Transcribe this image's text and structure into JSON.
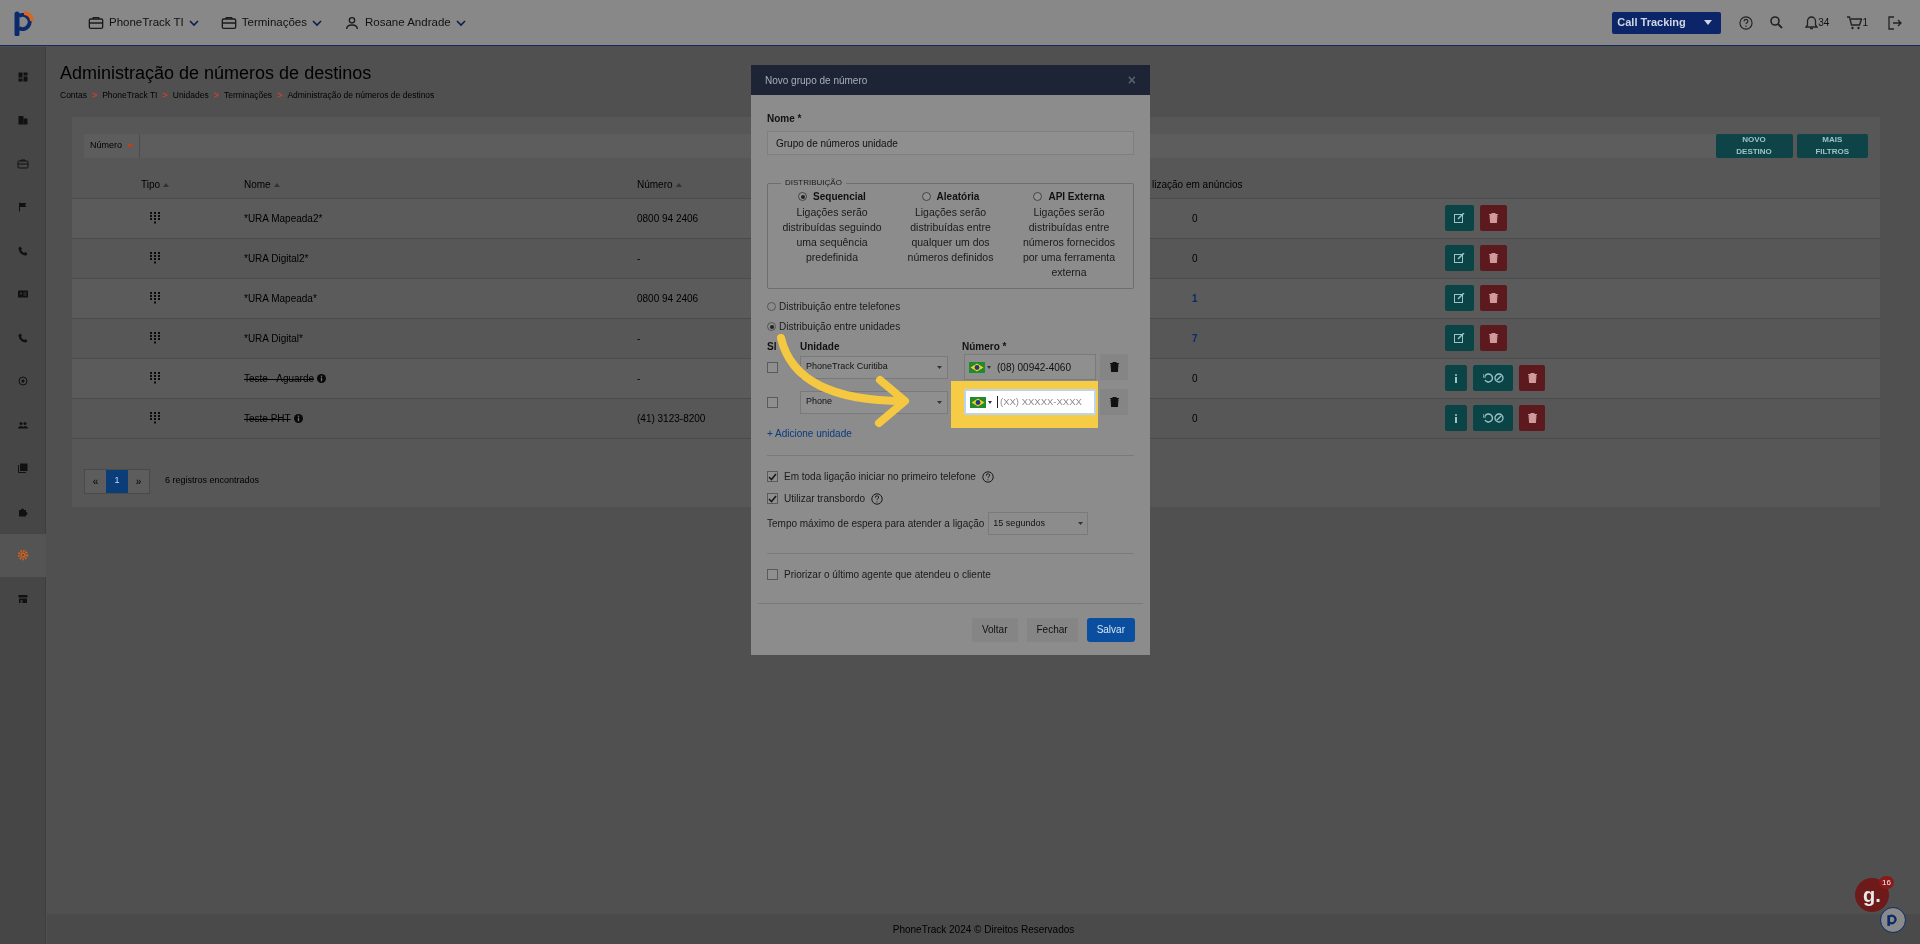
{
  "topbar": {
    "menus": [
      {
        "label": "PhoneTrack TI"
      },
      {
        "label": "Terminações"
      },
      {
        "label": "Rosane Andrade"
      }
    ],
    "product_select": "Call Tracking",
    "notifications": "34",
    "cart": "1"
  },
  "sidebar": {
    "items": [
      {
        "selected": false
      },
      {
        "selected": false
      },
      {
        "selected": false
      },
      {
        "selected": false
      },
      {
        "selected": false
      },
      {
        "selected": false
      },
      {
        "selected": false
      },
      {
        "selected": false
      },
      {
        "selected": false
      },
      {
        "selected": false
      },
      {
        "selected": false
      },
      {
        "selected": true
      },
      {
        "selected": false
      }
    ]
  },
  "page": {
    "title": "Administração de números de destinos",
    "breadcrumb": [
      "Contas",
      "PhoneTrack TI",
      "Unidades",
      "Terminações",
      "Administração de números de destinos"
    ],
    "separator": ">"
  },
  "filter": {
    "field_label": "Número",
    "buttons": [
      "NOVO DESTINO",
      "MAIS FILTROS"
    ]
  },
  "table": {
    "columns": [
      "Tipo",
      "Nome",
      "Número",
      "lização em anúncios"
    ],
    "rows": [
      {
        "name": "*URA Mapeada2*",
        "number": "0800 94 2406",
        "usage": "0",
        "usage_linked": false,
        "disabled": false
      },
      {
        "name": "*URA Digital2*",
        "number": "-",
        "usage": "0",
        "usage_linked": false,
        "disabled": false
      },
      {
        "name": "*URA Mapeada*",
        "number": "0800 94 2406",
        "usage": "1",
        "usage_linked": true,
        "disabled": false
      },
      {
        "name": "*URA Digital*",
        "number": "-",
        "usage": "7",
        "usage_linked": true,
        "disabled": false
      },
      {
        "name": "Teste - Aguarde",
        "number": "-",
        "usage": "0",
        "usage_linked": false,
        "disabled": true
      },
      {
        "name": "Teste PHT",
        "number": "(41) 3123-8200",
        "usage": "0",
        "usage_linked": false,
        "disabled": true
      }
    ]
  },
  "pagination": {
    "prev": "«",
    "pages": [
      {
        "label": "1",
        "selected": true
      }
    ],
    "next": "»",
    "summary": "6 registros encontrados"
  },
  "footer": "PhoneTrack 2024 © Direitos Reservados",
  "modal": {
    "title": "Novo grupo de número",
    "close": "×",
    "name_label": "Nome *",
    "name_value": "Grupo de números unidade",
    "distribution": {
      "legend": "DISTRIBUIÇÃO",
      "options": [
        {
          "title": "Sequencial",
          "description": "Ligações serão distribuídas seguindo uma sequência predefinida",
          "selected": true
        },
        {
          "title": "Aleatória",
          "description": "Ligações serão distribuídas entre qualquer um dos números definidos",
          "selected": false
        },
        {
          "title": "API Externa",
          "description": "Ligações serão distribuídas entre números fornecidos por uma ferramenta externa",
          "selected": false
        }
      ]
    },
    "modes": [
      {
        "label": "Distribuição entre telefones",
        "selected": false
      },
      {
        "label": "Distribuição entre unidades",
        "selected": true
      }
    ],
    "units": {
      "columns": [
        "Sl",
        "Unidade",
        "Número *"
      ],
      "rows": [
        {
          "checked": false,
          "unit": "PhoneTrack Curitiba",
          "number": "(08) 00942-4060",
          "highlighted": false
        },
        {
          "checked": false,
          "unit": "Phone",
          "placeholder": "(XX) XXXXX-XXXX",
          "highlighted": true
        }
      ]
    },
    "add_unit": "+ Adicione unidade",
    "options": [
      {
        "label": "Em toda ligação iniciar no primeiro telefone",
        "checked": true
      },
      {
        "label": "Utilizar transbordo",
        "checked": true
      }
    ],
    "wait": {
      "label": "Tempo máximo de espera para atender a ligação",
      "value": "15 segundos"
    },
    "prioritize": {
      "label": "Priorizar o último agente que atendeu o cliente",
      "checked": false
    },
    "buttons": [
      {
        "label": "Voltar",
        "kind": "secondary"
      },
      {
        "label": "Fechar",
        "kind": "secondary"
      },
      {
        "label": "Salvar",
        "kind": "primary"
      }
    ]
  },
  "widget": {
    "logo": "g.",
    "badge": "16"
  }
}
